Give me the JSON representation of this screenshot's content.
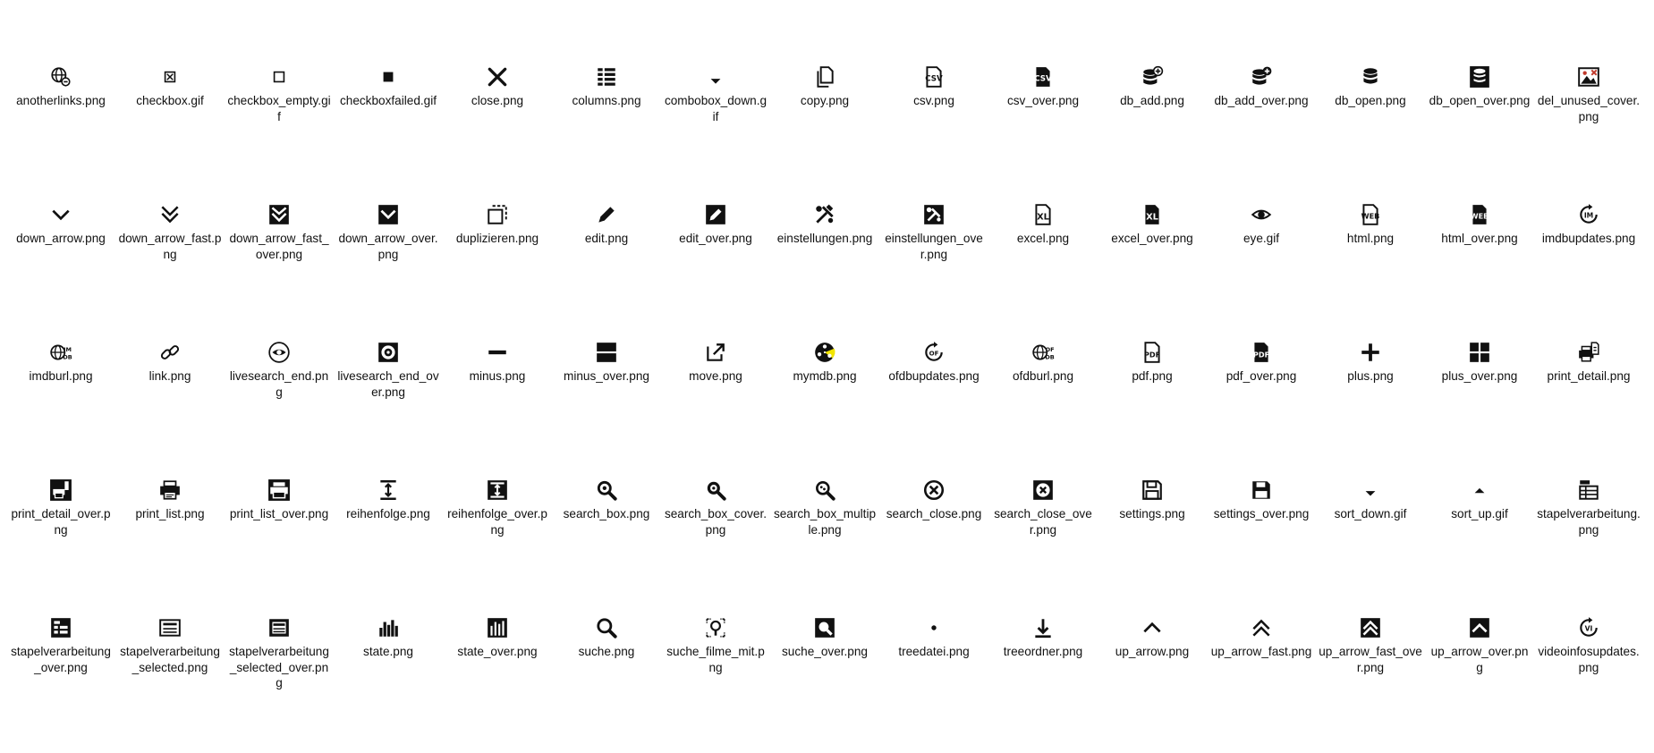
{
  "files": [
    {
      "name": "anotherlinks.png",
      "icon": "globe-link-icon"
    },
    {
      "name": "checkbox.gif",
      "icon": "checkbox-checked-icon"
    },
    {
      "name": "checkbox_empty.gif",
      "icon": "checkbox-empty-icon"
    },
    {
      "name": "checkboxfailed.gif",
      "icon": "checkbox-failed-icon"
    },
    {
      "name": "close.png",
      "icon": "close-icon"
    },
    {
      "name": "columns.png",
      "icon": "columns-icon"
    },
    {
      "name": "combobox_down.gif",
      "icon": "caret-down-icon"
    },
    {
      "name": "copy.png",
      "icon": "copy-icon"
    },
    {
      "name": "csv.png",
      "icon": "csv-icon"
    },
    {
      "name": "csv_over.png",
      "icon": "csv-filled-icon"
    },
    {
      "name": "db_add.png",
      "icon": "database-add-icon"
    },
    {
      "name": "db_add_over.png",
      "icon": "database-add-filled-icon"
    },
    {
      "name": "db_open.png",
      "icon": "database-icon"
    },
    {
      "name": "db_open_over.png",
      "icon": "database-filled-icon"
    },
    {
      "name": "del_unused_cover.png",
      "icon": "image-delete-icon"
    },
    {
      "name": "down_arrow.png",
      "icon": "chevron-down-icon"
    },
    {
      "name": "down_arrow_fast.png",
      "icon": "double-chevron-down-icon"
    },
    {
      "name": "down_arrow_fast_over.png",
      "icon": "double-chevron-down-filled-icon"
    },
    {
      "name": "down_arrow_over.png",
      "icon": "chevron-down-filled-icon"
    },
    {
      "name": "duplizieren.png",
      "icon": "duplicate-icon"
    },
    {
      "name": "edit.png",
      "icon": "pencil-icon"
    },
    {
      "name": "edit_over.png",
      "icon": "pencil-filled-icon"
    },
    {
      "name": "einstellungen.png",
      "icon": "tools-icon"
    },
    {
      "name": "einstellungen_over.png",
      "icon": "tools-filled-icon"
    },
    {
      "name": "excel.png",
      "icon": "excel-icon"
    },
    {
      "name": "excel_over.png",
      "icon": "excel-filled-icon"
    },
    {
      "name": "eye.gif",
      "icon": "eye-icon"
    },
    {
      "name": "html.png",
      "icon": "html-icon"
    },
    {
      "name": "html_over.png",
      "icon": "html-filled-icon"
    },
    {
      "name": "imdbupdates.png",
      "icon": "imdb-update-icon"
    },
    {
      "name": "imdburl.png",
      "icon": "imdb-globe-icon"
    },
    {
      "name": "link.png",
      "icon": "link-icon"
    },
    {
      "name": "livesearch_end.png",
      "icon": "eye-circle-icon"
    },
    {
      "name": "livesearch_end_over.png",
      "icon": "eye-circle-filled-icon"
    },
    {
      "name": "minus.png",
      "icon": "minus-icon"
    },
    {
      "name": "minus_over.png",
      "icon": "minus-filled-icon"
    },
    {
      "name": "move.png",
      "icon": "move-icon"
    },
    {
      "name": "mymdb.png",
      "icon": "film-reel-icon"
    },
    {
      "name": "ofdbupdates.png",
      "icon": "ofdb-update-icon"
    },
    {
      "name": "ofdburl.png",
      "icon": "ofdb-globe-icon"
    },
    {
      "name": "pdf.png",
      "icon": "pdf-icon"
    },
    {
      "name": "pdf_over.png",
      "icon": "pdf-filled-icon"
    },
    {
      "name": "plus.png",
      "icon": "plus-icon"
    },
    {
      "name": "plus_over.png",
      "icon": "plus-filled-icon"
    },
    {
      "name": "print_detail.png",
      "icon": "print-detail-icon"
    },
    {
      "name": "print_detail_over.png",
      "icon": "print-detail-filled-icon"
    },
    {
      "name": "print_list.png",
      "icon": "printer-icon"
    },
    {
      "name": "print_list_over.png",
      "icon": "printer-filled-icon"
    },
    {
      "name": "reihenfolge.png",
      "icon": "order-icon"
    },
    {
      "name": "reihenfolge_over.png",
      "icon": "order-filled-icon"
    },
    {
      "name": "search_box.png",
      "icon": "search-box-icon"
    },
    {
      "name": "search_box_cover.png",
      "icon": "search-box-cover-icon"
    },
    {
      "name": "search_box_multiple.png",
      "icon": "search-box-multiple-icon"
    },
    {
      "name": "search_close.png",
      "icon": "search-close-icon"
    },
    {
      "name": "search_close_over.png",
      "icon": "search-close-filled-icon"
    },
    {
      "name": "settings.png",
      "icon": "save-icon"
    },
    {
      "name": "settings_over.png",
      "icon": "save-filled-icon"
    },
    {
      "name": "sort_down.gif",
      "icon": "sort-down-icon"
    },
    {
      "name": "sort_up.gif",
      "icon": "sort-up-icon"
    },
    {
      "name": "stapelverarbeitung.png",
      "icon": "batch-icon"
    },
    {
      "name": "stapelverarbeitung_over.png",
      "icon": "batch-filled-icon"
    },
    {
      "name": "stapelverarbeitung_selected.png",
      "icon": "batch-selected-icon"
    },
    {
      "name": "stapelverarbeitung_selected_over.png",
      "icon": "batch-selected-filled-icon"
    },
    {
      "name": "state.png",
      "icon": "bar-chart-icon"
    },
    {
      "name": "state_over.png",
      "icon": "bar-chart-filled-icon"
    },
    {
      "name": "suche.png",
      "icon": "magnifier-icon"
    },
    {
      "name": "suche_filme_mit.png",
      "icon": "search-films-icon"
    },
    {
      "name": "suche_over.png",
      "icon": "magnifier-filled-icon"
    },
    {
      "name": "treedatei.png",
      "icon": "tree-file-icon"
    },
    {
      "name": "treeordner.png",
      "icon": "tree-folder-icon"
    },
    {
      "name": "up_arrow.png",
      "icon": "chevron-up-icon"
    },
    {
      "name": "up_arrow_fast.png",
      "icon": "double-chevron-up-icon"
    },
    {
      "name": "up_arrow_fast_over.png",
      "icon": "double-chevron-up-filled-icon"
    },
    {
      "name": "up_arrow_over.png",
      "icon": "chevron-up-filled-icon"
    },
    {
      "name": "videoinfosupdates.png",
      "icon": "video-info-update-icon"
    }
  ]
}
